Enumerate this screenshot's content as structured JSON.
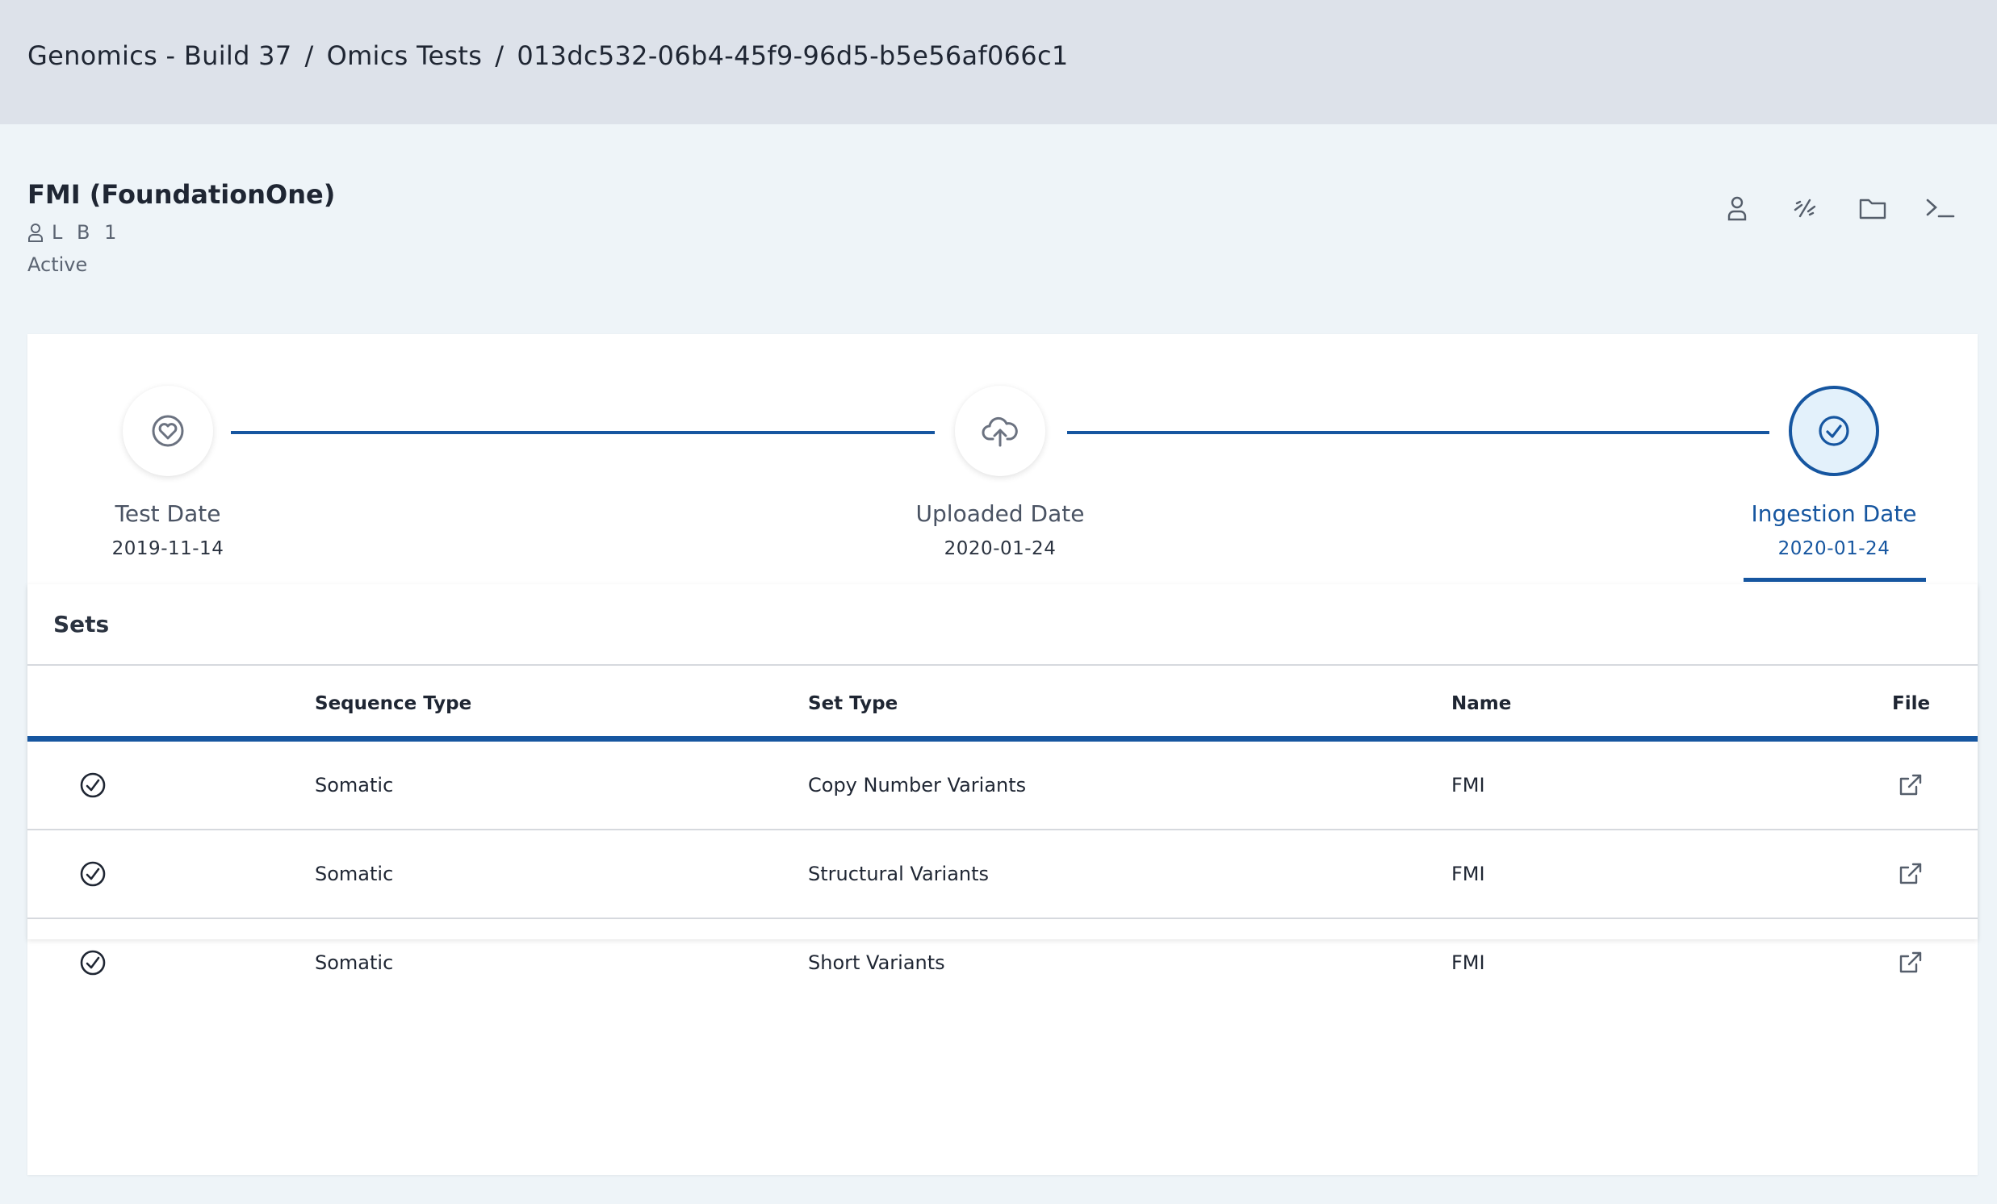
{
  "breadcrumb": {
    "items": [
      "Genomics - Build 37",
      "Omics Tests",
      "013dc532-06b4-45f9-96d5-b5e56af066c1"
    ],
    "separator": "/"
  },
  "header": {
    "title": "FMI (FoundationOne)",
    "owner": "L B 1",
    "status": "Active",
    "actions": [
      "person-icon",
      "link-broken-icon",
      "folder-icon",
      "terminal-icon"
    ]
  },
  "timeline": {
    "steps": [
      {
        "label": "Test Date",
        "date": "2019-11-14",
        "icon": "heart-badge-icon",
        "active": false
      },
      {
        "label": "Uploaded Date",
        "date": "2020-01-24",
        "icon": "cloud-upload-icon",
        "active": false
      },
      {
        "label": "Ingestion Date",
        "date": "2020-01-24",
        "icon": "check-circle-icon",
        "active": true
      }
    ]
  },
  "sets": {
    "title": "Sets",
    "columns": {
      "sequence_type": "Sequence Type",
      "set_type": "Set Type",
      "name": "Name",
      "file": "File"
    },
    "rows": [
      {
        "sequence_type": "Somatic",
        "set_type": "Copy Number Variants",
        "name": "FMI"
      },
      {
        "sequence_type": "Somatic",
        "set_type": "Structural Variants",
        "name": "FMI"
      },
      {
        "sequence_type": "Somatic",
        "set_type": "Short Variants",
        "name": "FMI"
      }
    ]
  },
  "colors": {
    "accent": "#1656a0",
    "topbar": "#dde2ea",
    "page_bg": "#eef4f8"
  }
}
